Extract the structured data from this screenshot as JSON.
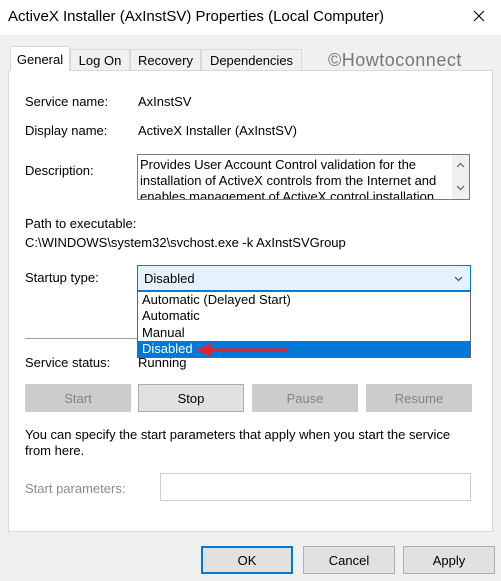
{
  "window": {
    "title": "ActiveX Installer (AxInstSV) Properties (Local Computer)",
    "close_icon": "close-icon"
  },
  "tabs": [
    {
      "label": "General",
      "active": true
    },
    {
      "label": "Log On",
      "active": false
    },
    {
      "label": "Recovery",
      "active": false
    },
    {
      "label": "Dependencies",
      "active": false
    }
  ],
  "watermark": "©Howtoconnect",
  "general": {
    "service_name_label": "Service name:",
    "service_name_value": "AxInstSV",
    "display_name_label": "Display name:",
    "display_name_value": "ActiveX Installer (AxInstSV)",
    "description_label": "Description:",
    "description_value": "Provides User Account Control validation for the installation of ActiveX controls from the Internet and enables management of ActiveX control installation",
    "path_label": "Path to executable:",
    "path_value": "C:\\WINDOWS\\system32\\svchost.exe -k AxInstSVGroup",
    "startup_type_label": "Startup type:",
    "startup_type_value": "Disabled",
    "startup_options": [
      {
        "label": "Automatic (Delayed Start)",
        "selected": false
      },
      {
        "label": "Automatic",
        "selected": false
      },
      {
        "label": "Manual",
        "selected": false
      },
      {
        "label": "Disabled",
        "selected": true
      }
    ],
    "service_status_label": "Service status:",
    "service_status_value": "Running",
    "buttons": {
      "start": "Start",
      "stop": "Stop",
      "pause": "Pause",
      "resume": "Resume"
    },
    "info_text": "You can specify the start parameters that apply when you start the service from here.",
    "start_params_label": "Start parameters:",
    "start_params_value": ""
  },
  "dialog_buttons": {
    "ok": "OK",
    "cancel": "Cancel",
    "apply": "Apply"
  },
  "colors": {
    "accent": "#0078d7",
    "annotation_arrow": "#e0242b"
  }
}
